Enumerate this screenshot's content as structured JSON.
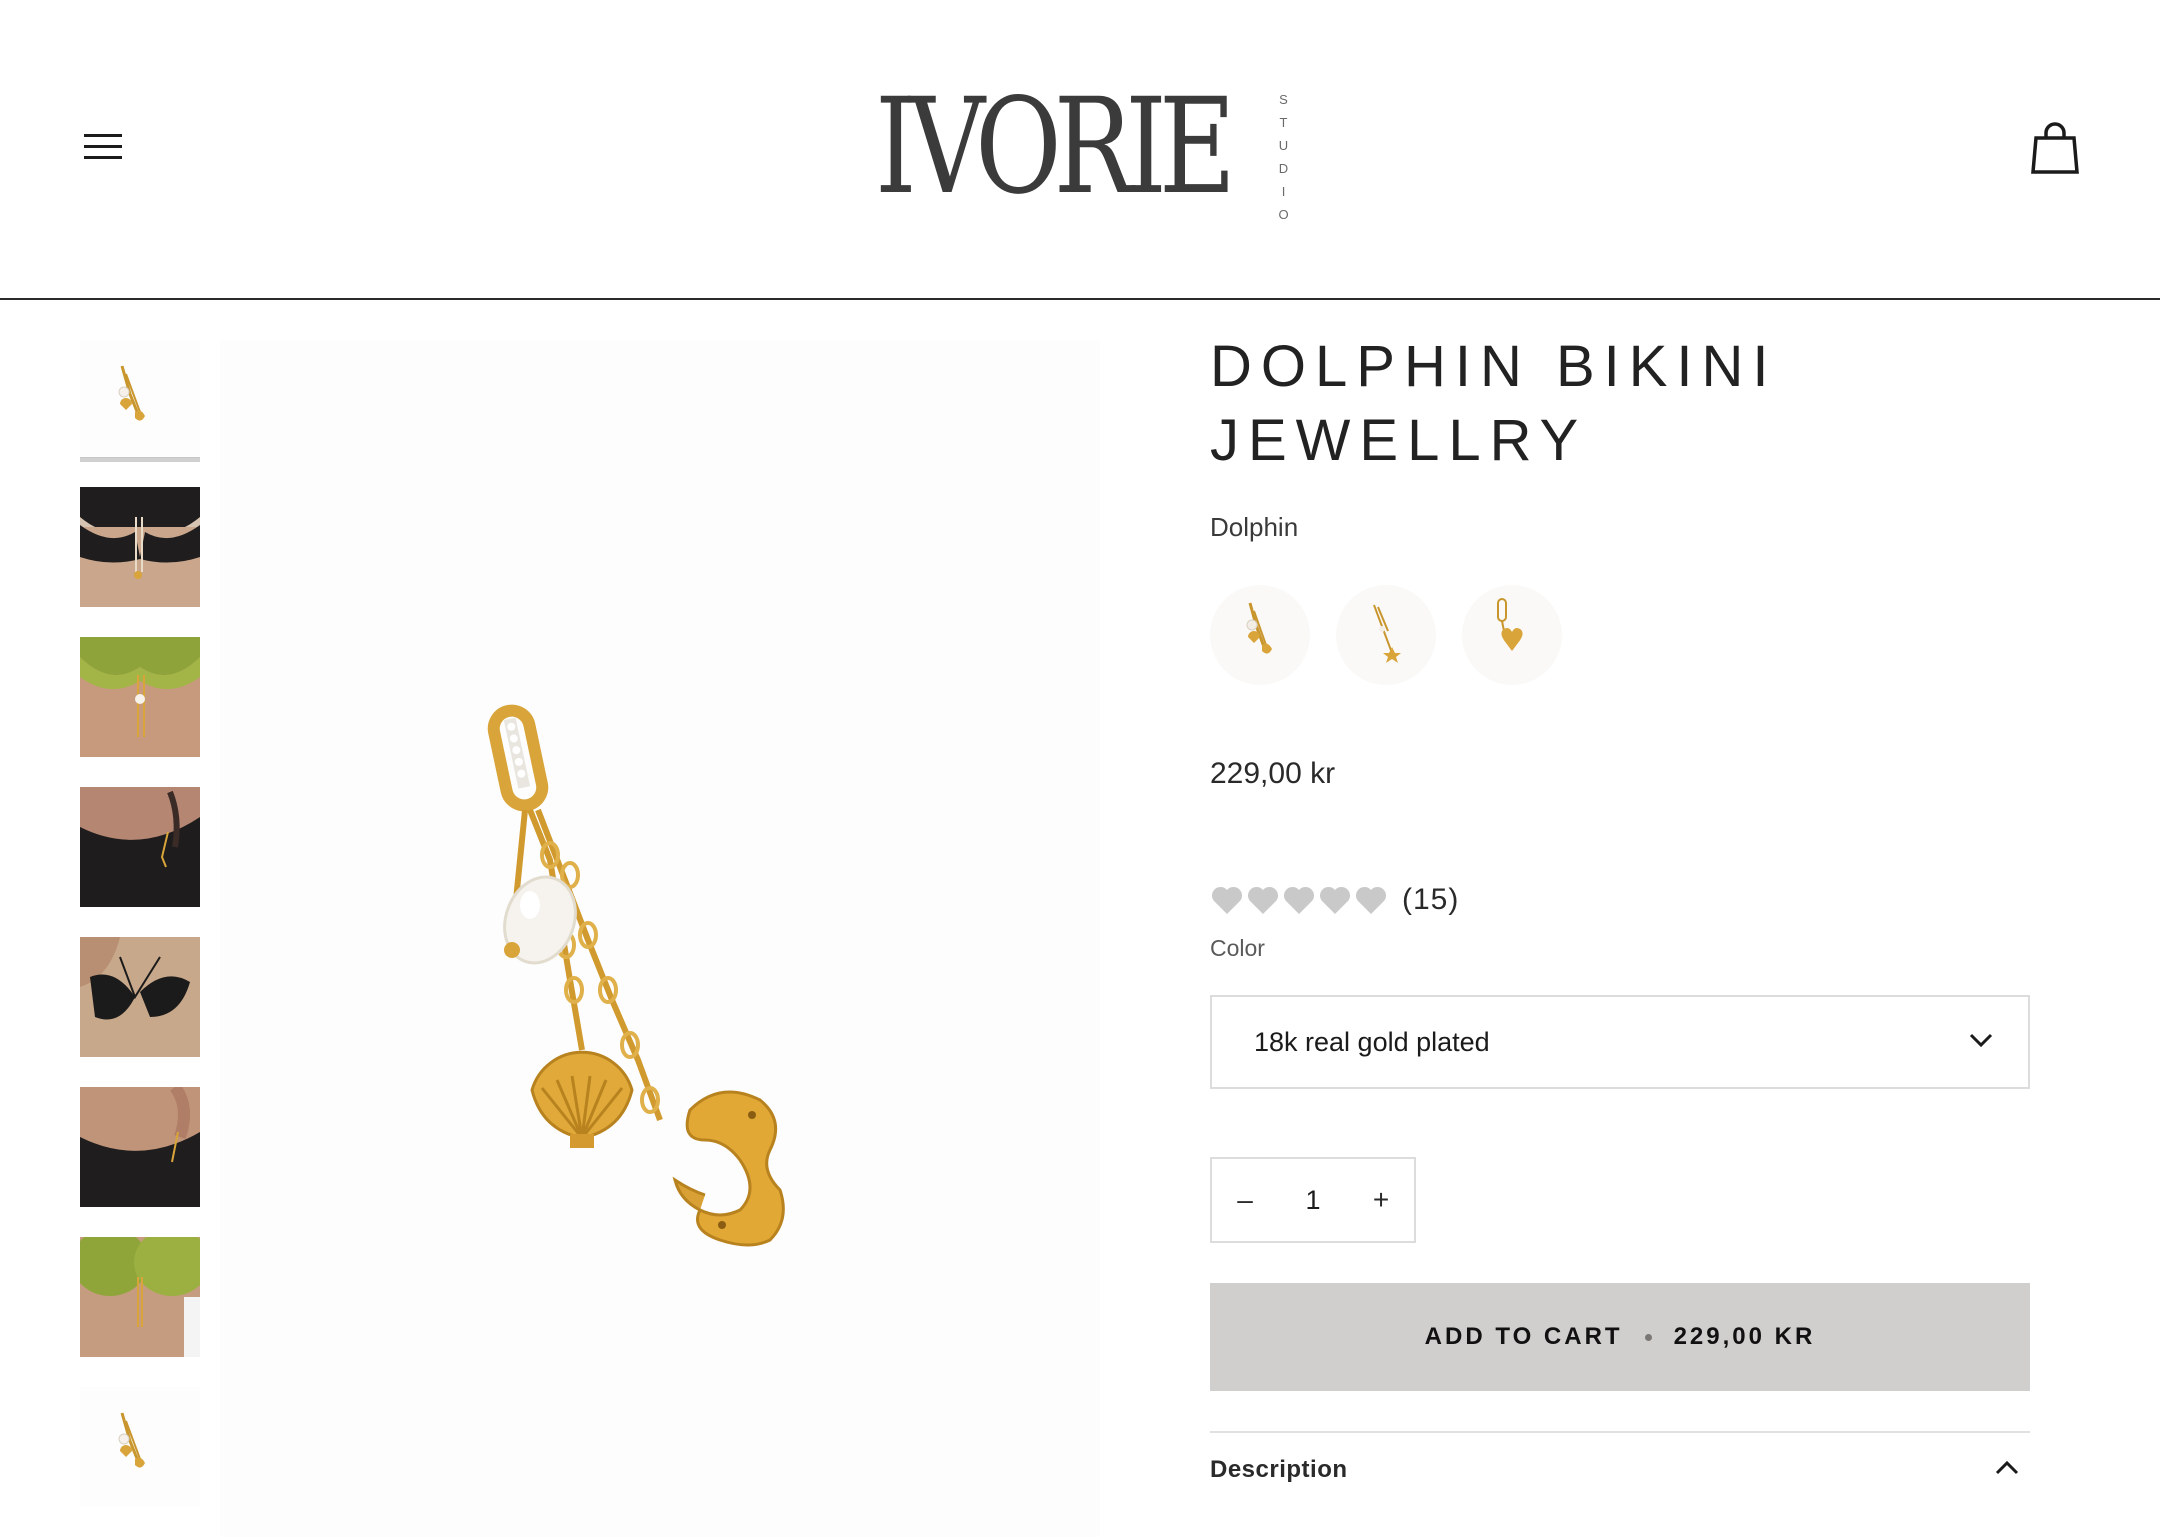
{
  "header": {
    "logo_main": "IVORIE",
    "logo_sub": "STUDIO",
    "menu_icon": "hamburger-menu-icon",
    "cart_icon": "shopping-bag-icon"
  },
  "gallery": {
    "thumbnails": [
      {
        "name": "charm-product"
      },
      {
        "name": "black-bikini-front"
      },
      {
        "name": "green-bikini-front"
      },
      {
        "name": "black-bikini-side"
      },
      {
        "name": "black-bikini-sand"
      },
      {
        "name": "black-bikini-hip"
      },
      {
        "name": "green-bikini-closeup"
      },
      {
        "name": "charm-product-alt"
      }
    ]
  },
  "product": {
    "title_line1": "DOLPHIN BIKINI",
    "title_line2": "JEWELLRY",
    "variant": "Dolphin",
    "price": "229,00 kr",
    "rating_count": "(15)",
    "rating_stars": 0,
    "color_label": "Color",
    "color_value": "18k real gold plated",
    "quantity": "1",
    "minus": "–",
    "plus": "+",
    "add_to_cart": "ADD TO CART",
    "add_to_cart_price": "229,00 KR",
    "description_label": "Description"
  },
  "colors": {
    "accent_button": "#d1cfcd",
    "gold": "#d9a53a"
  }
}
